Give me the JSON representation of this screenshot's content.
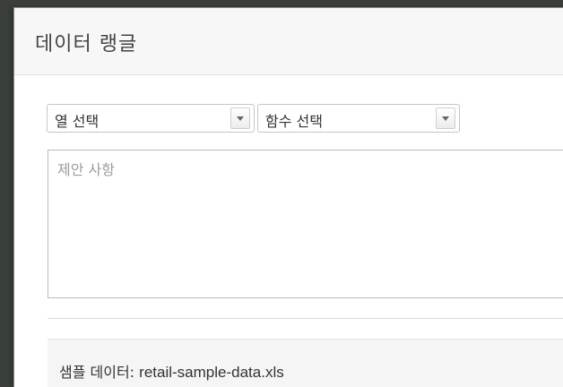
{
  "dialog": {
    "title": "데이터 랭글"
  },
  "selectors": {
    "column": {
      "selected": "열 선택"
    },
    "function": {
      "selected": "함수 선택"
    }
  },
  "suggestions": {
    "placeholder": "제안 사항"
  },
  "footer": {
    "label": "샘플 데이터: ",
    "filename": "retail-sample-data.xls"
  },
  "icons": {
    "dropdown": "chevron-down-icon"
  }
}
